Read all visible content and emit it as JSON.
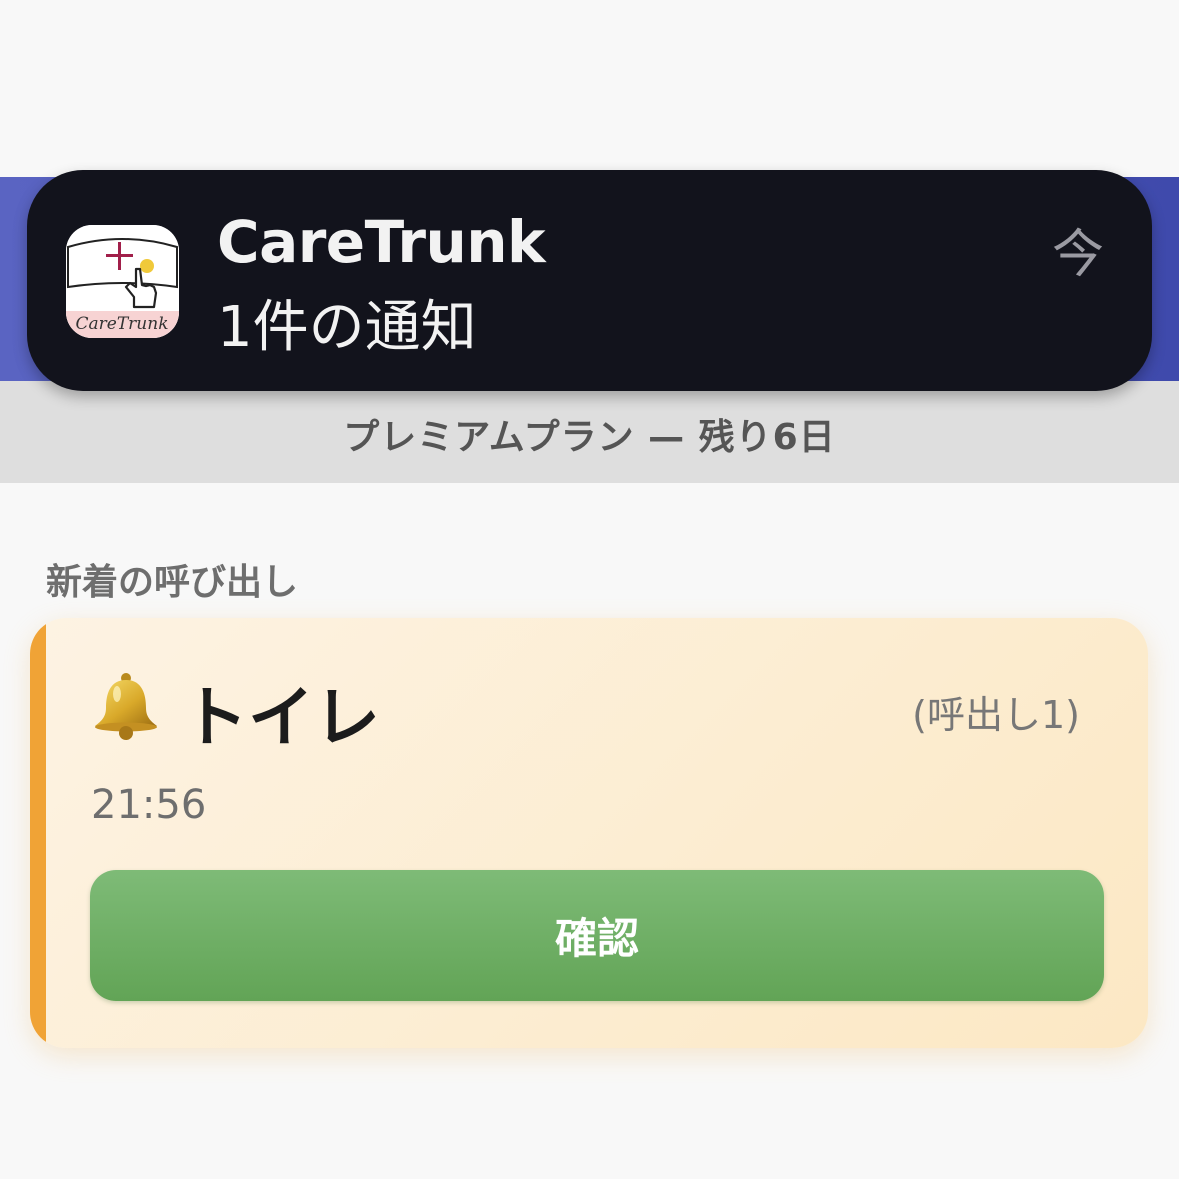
{
  "notification": {
    "app_name": "CareTrunk",
    "message": "1件の通知",
    "time": "今",
    "icon_label": "CareTrunk",
    "icon_name": "caretrunk-app-icon"
  },
  "plan_banner": {
    "text": "プレミアムプラン — 残り6日"
  },
  "section": {
    "title": "新着の呼び出し"
  },
  "call": {
    "icon": "bell-icon",
    "title": "トイレ",
    "channel": "(呼出し1)",
    "time": "21:56",
    "confirm_label": "確認"
  },
  "colors": {
    "header_band": "#4a54b6",
    "notification_bg": "#12131c",
    "card_accent": "#f0a336",
    "confirm_button": "#6aad60"
  }
}
